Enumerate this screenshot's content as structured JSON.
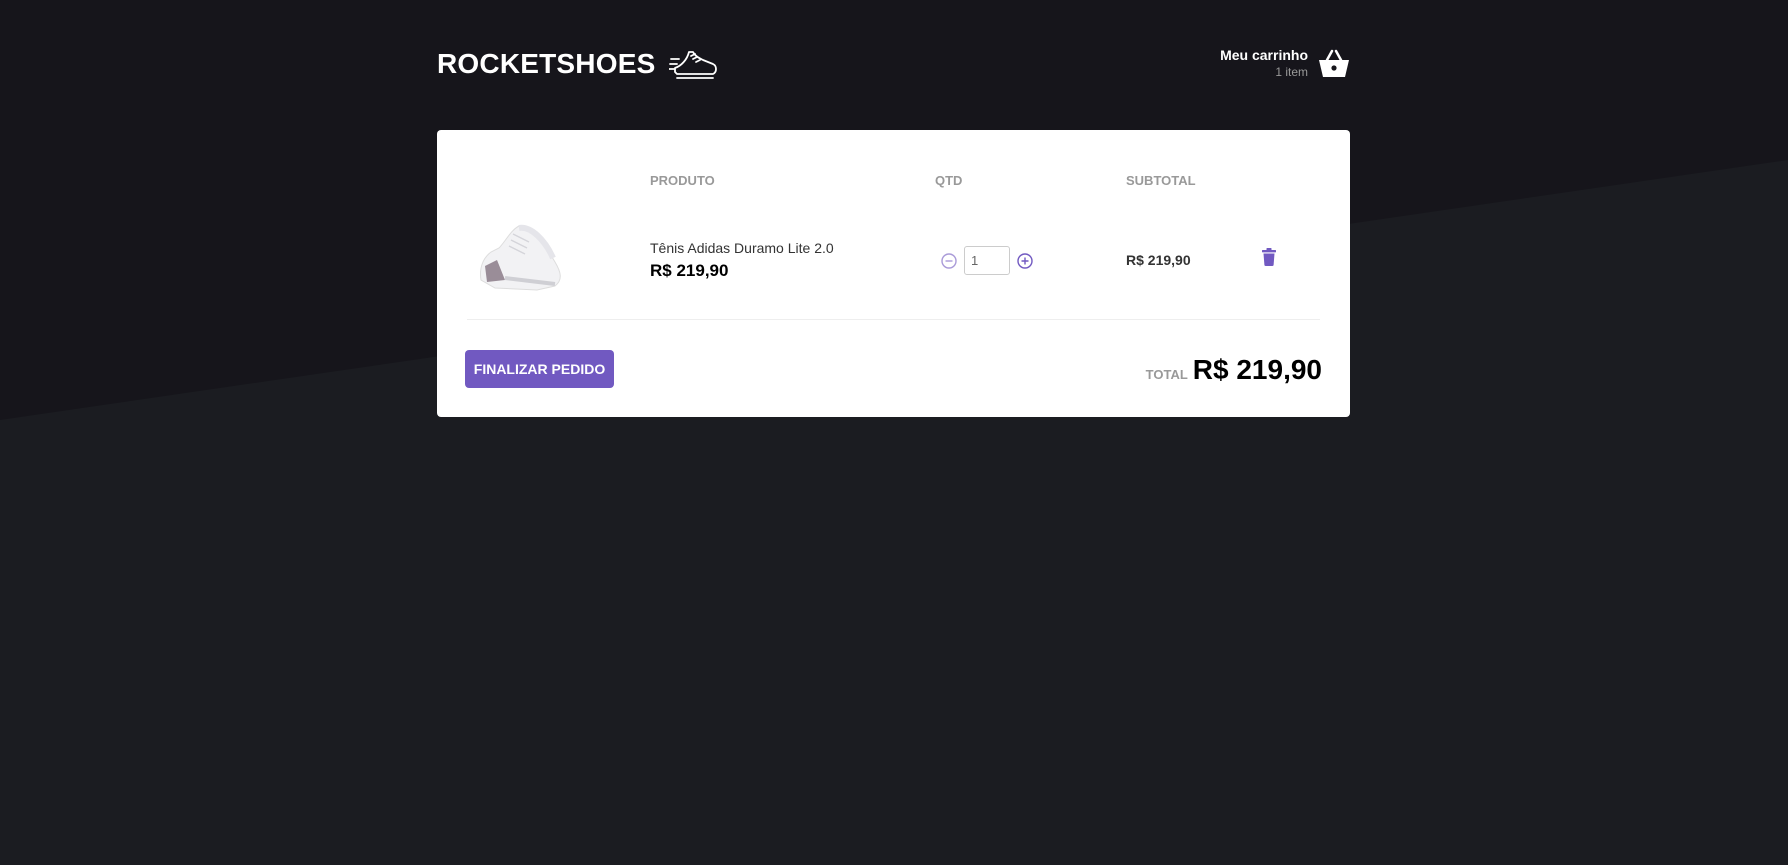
{
  "header": {
    "logo_text": "ROCKETSHOES",
    "cart_title": "Meu carrinho",
    "cart_count": "1 item"
  },
  "table": {
    "headers": {
      "product": "PRODUTO",
      "qty": "QTD",
      "subtotal": "SUBTOTAL"
    },
    "rows": [
      {
        "name": "Tênis Adidas Duramo Lite 2.0",
        "price": "R$ 219,90",
        "quantity": "1",
        "subtotal": "R$ 219,90",
        "image_icon": "sneaker-image"
      }
    ]
  },
  "footer": {
    "finalize_label": "FINALIZAR PEDIDO",
    "total_label": "TOTAL",
    "total_value": "R$ 219,90"
  },
  "colors": {
    "accent": "#7159c1",
    "background": "#191920",
    "panel": "#ffffff"
  }
}
